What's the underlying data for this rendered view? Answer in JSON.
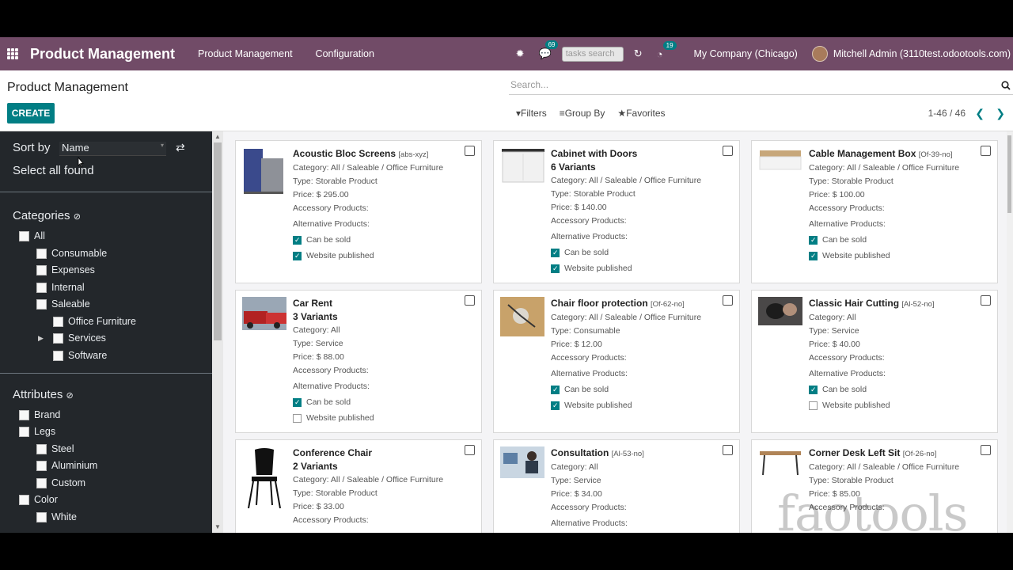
{
  "app": {
    "title": "Product Management",
    "menu": [
      "Product Management",
      "Configuration"
    ],
    "chat_badge": "69",
    "tasks_search_placeholder": "tasks search",
    "activity_badge": "19",
    "company": "My Company (Chicago)",
    "user": "Mitchell Admin (3110test.odootools.com)"
  },
  "control_panel": {
    "page_title": "Product Management",
    "create_label": "CREATE",
    "search_placeholder": "Search...",
    "filters_label": "Filters",
    "groupby_label": "Group By",
    "favorites_label": "Favorites",
    "pager": "1-46 / 46"
  },
  "sidebar": {
    "sort_by_label": "Sort by",
    "sort_value": "Name",
    "select_all_label": "Select all found",
    "categories_title": "Categories",
    "categories": [
      "All",
      "Consumable",
      "Expenses",
      "Internal",
      "Saleable",
      "Office Furniture",
      "Services",
      "Software"
    ],
    "attributes_title": "Attributes",
    "attributes": [
      "Brand",
      "Legs",
      "Steel",
      "Aluminium",
      "Custom",
      "Color",
      "White"
    ]
  },
  "labels": {
    "accessory": "Accessory Products:",
    "alternative": "Alternative Products:",
    "can_be_sold": "Can be sold",
    "website_published": "Website published"
  },
  "products": [
    {
      "name": "Acoustic Bloc Screens",
      "ref": "[abs-xyz]",
      "variants": "",
      "category": "Category: All / Saleable / Office Furniture",
      "type": "Type: Storable Product",
      "price": "Price: $ 295.00",
      "can_be_sold": true,
      "website_published": true
    },
    {
      "name": "Cabinet with Doors",
      "ref": "",
      "variants": "6 Variants",
      "category": "Category: All / Saleable / Office Furniture",
      "type": "Type: Storable Product",
      "price": "Price: $ 140.00",
      "can_be_sold": true,
      "website_published": true
    },
    {
      "name": "Cable Management Box",
      "ref": "[Of-39-no]",
      "variants": "",
      "category": "Category: All / Saleable / Office Furniture",
      "type": "Type: Storable Product",
      "price": "Price: $ 100.00",
      "can_be_sold": true,
      "website_published": true
    },
    {
      "name": "Car Rent",
      "ref": "",
      "variants": "3 Variants",
      "category": "Category: All",
      "type": "Type: Service",
      "price": "Price: $ 88.00",
      "can_be_sold": true,
      "website_published": false
    },
    {
      "name": "Chair floor protection",
      "ref": "[Of-62-no]",
      "variants": "",
      "category": "Category: All / Saleable / Office Furniture",
      "type": "Type: Consumable",
      "price": "Price: $ 12.00",
      "can_be_sold": true,
      "website_published": true
    },
    {
      "name": "Classic Hair Cutting",
      "ref": "[Al-52-no]",
      "variants": "",
      "category": "Category: All",
      "type": "Type: Service",
      "price": "Price: $ 40.00",
      "can_be_sold": true,
      "website_published": false
    },
    {
      "name": "Conference Chair",
      "ref": "",
      "variants": "2 Variants",
      "category": "Category: All / Saleable / Office Furniture",
      "type": "Type: Storable Product",
      "price": "Price: $ 33.00"
    },
    {
      "name": "Consultation",
      "ref": "[Al-53-no]",
      "variants": "",
      "category": "Category: All",
      "type": "Type: Service",
      "price": "Price: $ 34.00"
    },
    {
      "name": "Corner Desk Left Sit",
      "ref": "[Of-26-no]",
      "variants": "",
      "category": "Category: All / Saleable / Office Furniture",
      "type": "Type: Storable Product",
      "price": "Price: $ 85.00"
    }
  ],
  "watermark": "faotools"
}
